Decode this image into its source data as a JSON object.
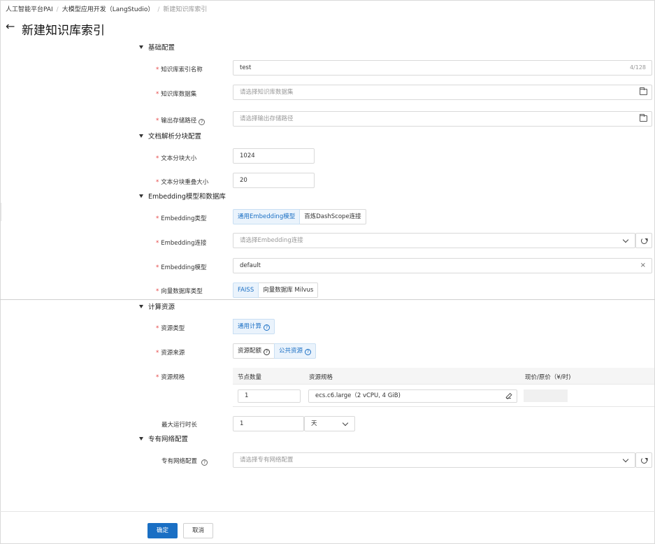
{
  "breadcrumb": [
    "人工智能平台PAI",
    "大模型应用开发（LangStudio）",
    "新建知识库索引"
  ],
  "page": {
    "back": "←",
    "title": "新建知识库索引"
  },
  "sections": {
    "basic": "基础配置",
    "chunk": "文档解析分块配置",
    "embedding": "Embedding模型和数据库",
    "compute": "计算资源",
    "vpc": "专有网络配置"
  },
  "req": "*",
  "help": "?",
  "fields": {
    "index_name": {
      "label": "知识库索引名称",
      "value": "test",
      "counter": "4/128"
    },
    "dataset": {
      "label": "知识库数据集",
      "placeholder": "请选择知识库数据集"
    },
    "output": {
      "label": "输出存储路径",
      "placeholder": "请选择输出存储路径"
    },
    "chunk_size": {
      "label": "文本分块大小",
      "value": "1024"
    },
    "chunk_overlap": {
      "label": "文本分块重叠大小",
      "value": "20"
    },
    "emb_type": {
      "label": "Embedding类型",
      "options": [
        "通用Embedding模型",
        "百炼DashScope连接"
      ],
      "selected": 0
    },
    "emb_conn": {
      "label": "Embedding连接",
      "placeholder": "请选择Embedding连接"
    },
    "emb_model": {
      "label": "Embedding模型",
      "value": "default",
      "clear": "×"
    },
    "vector_db": {
      "label": "向量数据库类型",
      "options": [
        "FAISS",
        "向量数据库 Milvus"
      ],
      "selected": 0
    },
    "res_type": {
      "label": "资源类型",
      "options": [
        "通用计算"
      ],
      "selected": 0
    },
    "res_source": {
      "label": "资源来源",
      "options": [
        "资源配额",
        "公共资源"
      ],
      "selected": 1
    },
    "res_spec": {
      "label": "资源规格",
      "columns": [
        "节点数量",
        "资源规格",
        "现价/原价（¥/时)"
      ],
      "row": {
        "nodes": "1",
        "spec": "ecs.c6.large（2 vCPU, 4 GiB)"
      }
    },
    "max_runtime": {
      "label": "最大运行时长",
      "value": "1",
      "unit": "天"
    },
    "vpc": {
      "label": "专有网络配置",
      "placeholder": "请选择专有网络配置"
    }
  },
  "footer": {
    "confirm": "确定",
    "cancel": "取消"
  }
}
